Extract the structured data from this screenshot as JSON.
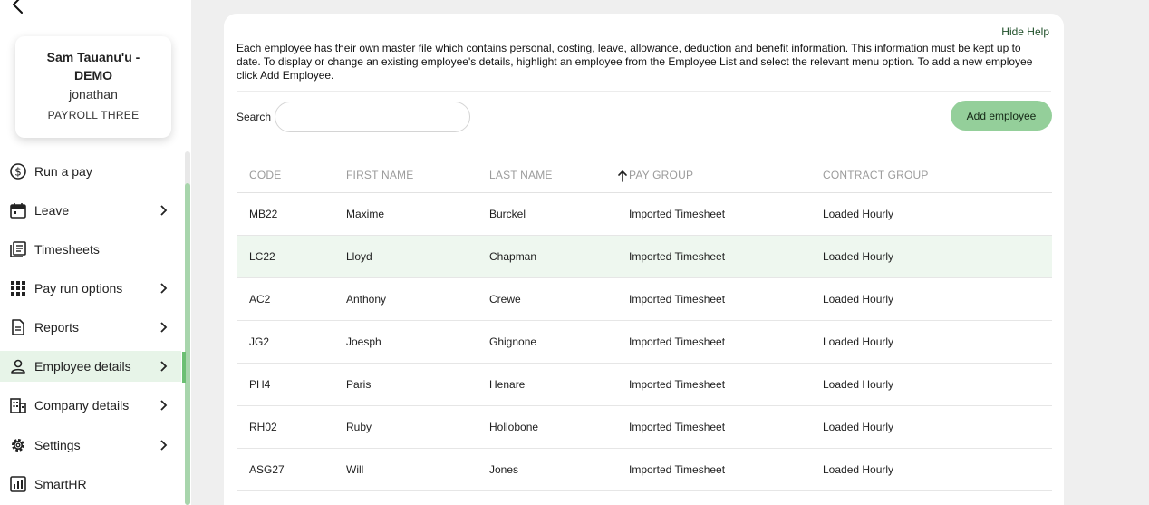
{
  "user": {
    "name": "Sam Tauanu'u - DEMO",
    "username": "jonathan",
    "company": "PAYROLL THREE"
  },
  "nav": [
    {
      "label": "Run a pay",
      "icon": "dollar-circle-icon",
      "chevron": false,
      "active": false
    },
    {
      "label": "Leave",
      "icon": "calendar-icon",
      "chevron": true,
      "active": false
    },
    {
      "label": "Timesheets",
      "icon": "timesheets-icon",
      "chevron": false,
      "active": false
    },
    {
      "label": "Pay run options",
      "icon": "grid-dots-icon",
      "chevron": true,
      "active": false
    },
    {
      "label": "Reports",
      "icon": "document-icon",
      "chevron": true,
      "active": false
    },
    {
      "label": "Employee details",
      "icon": "person-icon",
      "chevron": true,
      "active": true
    },
    {
      "label": "Company details",
      "icon": "building-icon",
      "chevron": true,
      "active": false
    },
    {
      "label": "Settings",
      "icon": "gear-icon",
      "chevron": true,
      "active": false
    },
    {
      "label": "SmartHR",
      "icon": "smarthr-icon",
      "chevron": false,
      "active": false
    }
  ],
  "help": {
    "hide_label": "Hide Help",
    "text": "Each employee has their own master file which contains personal, costing, leave, allowance, deduction and benefit information. This information must be kept up to date. To display or change an existing employee's details, highlight an employee from the Employee List and select the relevant menu option. To add a new employee click Add Employee."
  },
  "search": {
    "label": "Search",
    "value": "",
    "placeholder": ""
  },
  "add_button": "Add employee",
  "table": {
    "columns": [
      "CODE",
      "FIRST NAME",
      "LAST NAME",
      "PAY GROUP",
      "CONTRACT GROUP"
    ],
    "sorted_column": "PAY GROUP",
    "rows": [
      [
        "MB22",
        "Maxime",
        "Burckel",
        "Imported Timesheet",
        "Loaded Hourly"
      ],
      [
        "LC22",
        "Lloyd",
        "Chapman",
        "Imported Timesheet",
        "Loaded Hourly"
      ],
      [
        "AC2",
        "Anthony",
        "Crewe",
        "Imported Timesheet",
        "Loaded Hourly"
      ],
      [
        "JG2",
        "Joesph",
        "Ghignone",
        "Imported Timesheet",
        "Loaded Hourly"
      ],
      [
        "PH4",
        "Paris",
        "Henare",
        "Imported Timesheet",
        "Loaded Hourly"
      ],
      [
        "RH02",
        "Ruby",
        "Hollobone",
        "Imported Timesheet",
        "Loaded Hourly"
      ],
      [
        "ASG27",
        "Will",
        "Jones",
        "Imported Timesheet",
        "Loaded Hourly"
      ]
    ],
    "selected_row": 1
  },
  "colors": {
    "accent": "#94cf9a",
    "active_bar": "#6cbf73",
    "selected_row": "#eef7ef",
    "link": "#1f4f29"
  }
}
